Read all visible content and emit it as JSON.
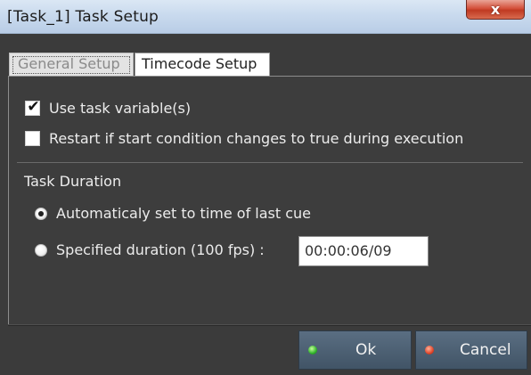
{
  "window": {
    "title": "[Task_1] Task Setup",
    "close_glyph": "x"
  },
  "tabs": [
    {
      "label": "General Setup",
      "active": true
    },
    {
      "label": "Timecode Setup",
      "active": false
    }
  ],
  "options": {
    "use_task_variables": {
      "label": "Use task variable(s)",
      "checked": true
    },
    "restart_on_change": {
      "label": "Restart if start condition changes to true during execution",
      "checked": false
    }
  },
  "task_duration": {
    "heading": "Task Duration",
    "auto": {
      "label": "Automaticaly set to time of last cue",
      "selected": true
    },
    "specified": {
      "label": "Specified duration (100 fps) :",
      "selected": false
    },
    "value": "00:00:06/09"
  },
  "buttons": {
    "ok": "Ok",
    "cancel": "Cancel"
  },
  "colors": {
    "title_bar": "#c9daee",
    "close_button": "#d4503a",
    "client_background": "#3b3b3b",
    "button": "#4c6074",
    "ok_led": "#2fb22a",
    "cancel_led": "#e0452a"
  },
  "icons": {
    "close": "close-icon",
    "checkbox_checked": "check-icon",
    "ok_indicator": "green-led-icon",
    "cancel_indicator": "red-led-icon"
  }
}
